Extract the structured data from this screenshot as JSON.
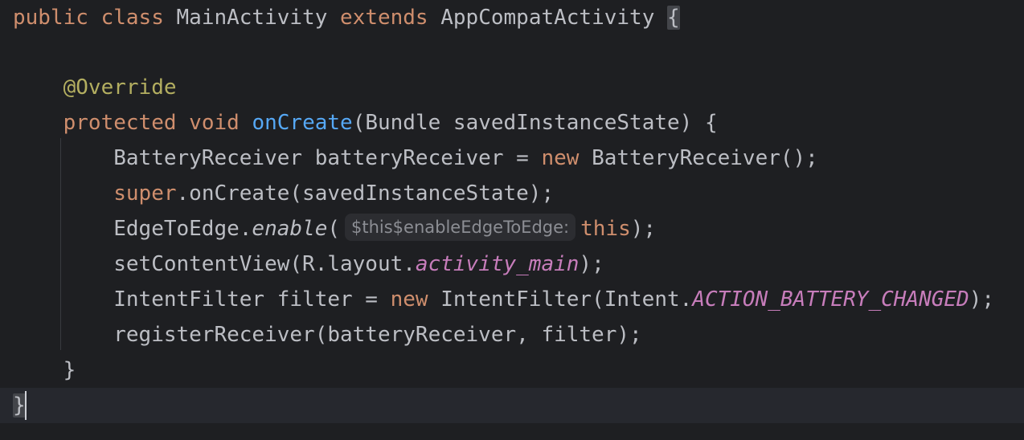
{
  "editor": {
    "language": "Java",
    "lines": [
      {
        "tokens": [
          {
            "text": "public",
            "kind": "keyword"
          },
          {
            "text": " ",
            "kind": "plain"
          },
          {
            "text": "class",
            "kind": "keyword"
          },
          {
            "text": " MainActivity ",
            "kind": "plain"
          },
          {
            "text": "extends",
            "kind": "keyword"
          },
          {
            "text": " AppCompatActivity ",
            "kind": "plain"
          },
          {
            "text": "{",
            "kind": "brace-match"
          }
        ]
      },
      {
        "tokens": []
      },
      {
        "indent": "    ",
        "tokens": [
          {
            "text": "@Override",
            "kind": "annotation"
          }
        ]
      },
      {
        "indent": "    ",
        "tokens": [
          {
            "text": "protected",
            "kind": "keyword"
          },
          {
            "text": " ",
            "kind": "plain"
          },
          {
            "text": "void",
            "kind": "keyword"
          },
          {
            "text": " ",
            "kind": "plain"
          },
          {
            "text": "onCreate",
            "kind": "function"
          },
          {
            "text": "(Bundle savedInstanceState) {",
            "kind": "plain"
          }
        ]
      },
      {
        "indent": "        ",
        "tokens": [
          {
            "text": "BatteryReceiver batteryReceiver = ",
            "kind": "plain"
          },
          {
            "text": "new",
            "kind": "keyword"
          },
          {
            "text": " BatteryReceiver();",
            "kind": "plain"
          }
        ]
      },
      {
        "indent": "        ",
        "tokens": [
          {
            "text": "super",
            "kind": "keyword"
          },
          {
            "text": ".onCreate(savedInstanceState);",
            "kind": "plain"
          }
        ]
      },
      {
        "indent": "        ",
        "tokens": [
          {
            "text": "EdgeToEdge.",
            "kind": "plain"
          },
          {
            "text": "enable",
            "kind": "static-call"
          },
          {
            "text": "(",
            "kind": "plain"
          },
          {
            "text": "$this$enableEdgeToEdge:",
            "kind": "hint"
          },
          {
            "text": "this",
            "kind": "keyword"
          },
          {
            "text": ");",
            "kind": "plain"
          }
        ]
      },
      {
        "indent": "        ",
        "tokens": [
          {
            "text": "setContentView(R.layout.",
            "kind": "plain"
          },
          {
            "text": "activity_main",
            "kind": "field"
          },
          {
            "text": ");",
            "kind": "plain"
          }
        ]
      },
      {
        "indent": "        ",
        "tokens": [
          {
            "text": "IntentFilter filter = ",
            "kind": "plain"
          },
          {
            "text": "new",
            "kind": "keyword"
          },
          {
            "text": " IntentFilter(Intent.",
            "kind": "plain"
          },
          {
            "text": "ACTION_BATTERY_CHANGED",
            "kind": "field"
          },
          {
            "text": ");",
            "kind": "plain"
          }
        ]
      },
      {
        "indent": "        ",
        "tokens": [
          {
            "text": "registerReceiver(batteryReceiver, filter);",
            "kind": "plain"
          }
        ]
      },
      {
        "indent": "    ",
        "tokens": [
          {
            "text": "}",
            "kind": "plain"
          }
        ]
      },
      {
        "tokens": [
          {
            "text": "}",
            "kind": "brace-match"
          }
        ]
      }
    ],
    "colors": {
      "background": "#1e1f22",
      "current_line": "#26282e",
      "keyword": "#cf8e6d",
      "annotation": "#b3ae60",
      "function": "#56a8f5",
      "field": "#c77dbb",
      "plain": "#bcbec4",
      "hint_text": "#8c8e94",
      "hint_background": "#2c2d31"
    }
  }
}
